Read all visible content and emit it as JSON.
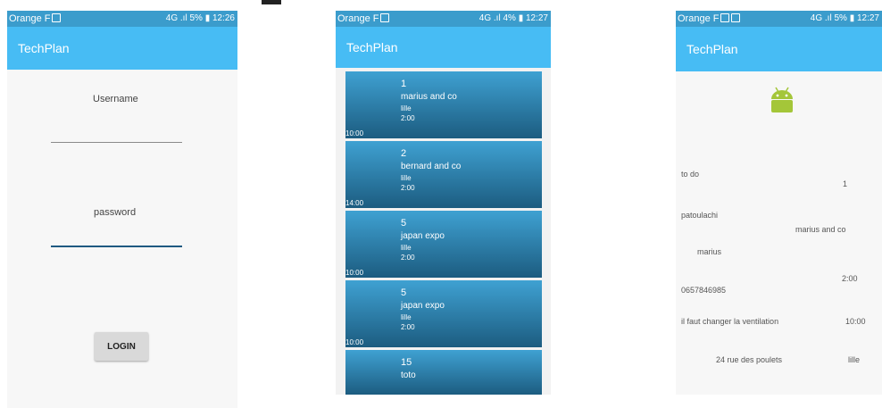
{
  "login": {
    "status": {
      "carrier": "Orange F",
      "right": "4G .ıl 5% ▮ 12:26"
    },
    "app_title": "TechPlan",
    "username_label": "Username",
    "password_label": "password",
    "login_button": "LOGIN"
  },
  "list": {
    "status": {
      "carrier": "Orange F",
      "right": "4G .ıl 4% ▮ 12:27"
    },
    "app_title": "TechPlan",
    "items": [
      {
        "num": "1",
        "name": "marius and co",
        "city": "lille",
        "duration": "2:00",
        "time": "10:00"
      },
      {
        "num": "2",
        "name": "bernard and co",
        "city": "lille",
        "duration": "2:00",
        "time": "14:00"
      },
      {
        "num": "5",
        "name": "japan expo",
        "city": "lille",
        "duration": "2:00",
        "time": "10:00"
      },
      {
        "num": "5",
        "name": "japan expo",
        "city": "lille",
        "duration": "2:00",
        "time": "10:00"
      },
      {
        "num": "15",
        "name": "toto",
        "city": "",
        "duration": "",
        "time": ""
      }
    ]
  },
  "detail": {
    "status": {
      "carrier": "Orange F",
      "right": "4G .ıl 5% ▮ 12:27"
    },
    "app_title": "TechPlan",
    "status_value": "to do",
    "number": "1",
    "contact_first": "patoulachi",
    "company": "marius and co",
    "contact_last": "marius",
    "duration": "2:00",
    "phone": "0657846985",
    "description": "il faut changer la ventilation",
    "time": "10:00",
    "address": "24 rue des poulets",
    "city": "lille",
    "android_color": "#a4c639"
  }
}
